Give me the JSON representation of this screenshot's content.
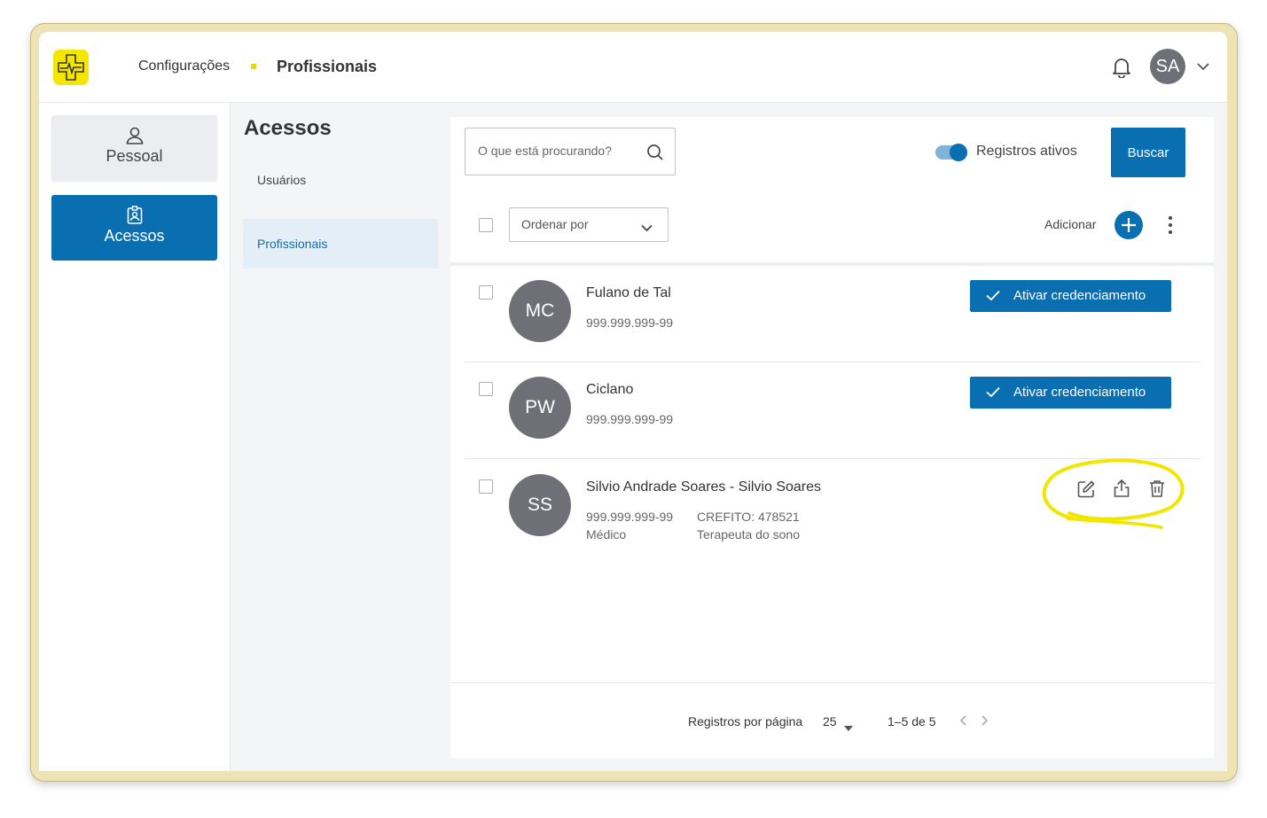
{
  "header": {
    "breadcrumb_parent": "Configurações",
    "breadcrumb_current": "Profissionais",
    "user_initials": "SA"
  },
  "sidebar": {
    "items": [
      {
        "label": "Pessoal",
        "icon": "user-icon"
      },
      {
        "label": "Acessos",
        "icon": "badge-icon",
        "active": true
      }
    ]
  },
  "subnav": {
    "title": "Acessos",
    "items": [
      {
        "label": "Usuários"
      },
      {
        "label": "Profissionais",
        "active": true
      }
    ]
  },
  "toolbar": {
    "search_placeholder": "O que está procurando?",
    "toggle_label": "Registros ativos",
    "toggle_on": true,
    "search_button": "Buscar",
    "order_label": "Ordenar por",
    "add_label": "Adicionar"
  },
  "rows": [
    {
      "initials": "MC",
      "name": "Fulano de Tal",
      "doc": "999.999.999-99",
      "action": "Ativar credenciamento"
    },
    {
      "initials": "PW",
      "name": "Ciclano",
      "doc": "999.999.999-99",
      "action": "Ativar credenciamento"
    },
    {
      "initials": "SS",
      "name": "Silvio Andrade Soares - Silvio Soares",
      "doc": "999.999.999-99",
      "role": "Médico",
      "crefito": "CREFITO: 478521",
      "specialty": "Terapeuta do sono"
    }
  ],
  "footer": {
    "per_page_label": "Registros por página",
    "per_page_value": "25",
    "range": "1–5 de 5"
  },
  "colors": {
    "primary": "#0a6fb1",
    "brand_yellow": "#f5e600",
    "avatar_gray": "#6f6f77",
    "highlight": "#f2e600"
  }
}
